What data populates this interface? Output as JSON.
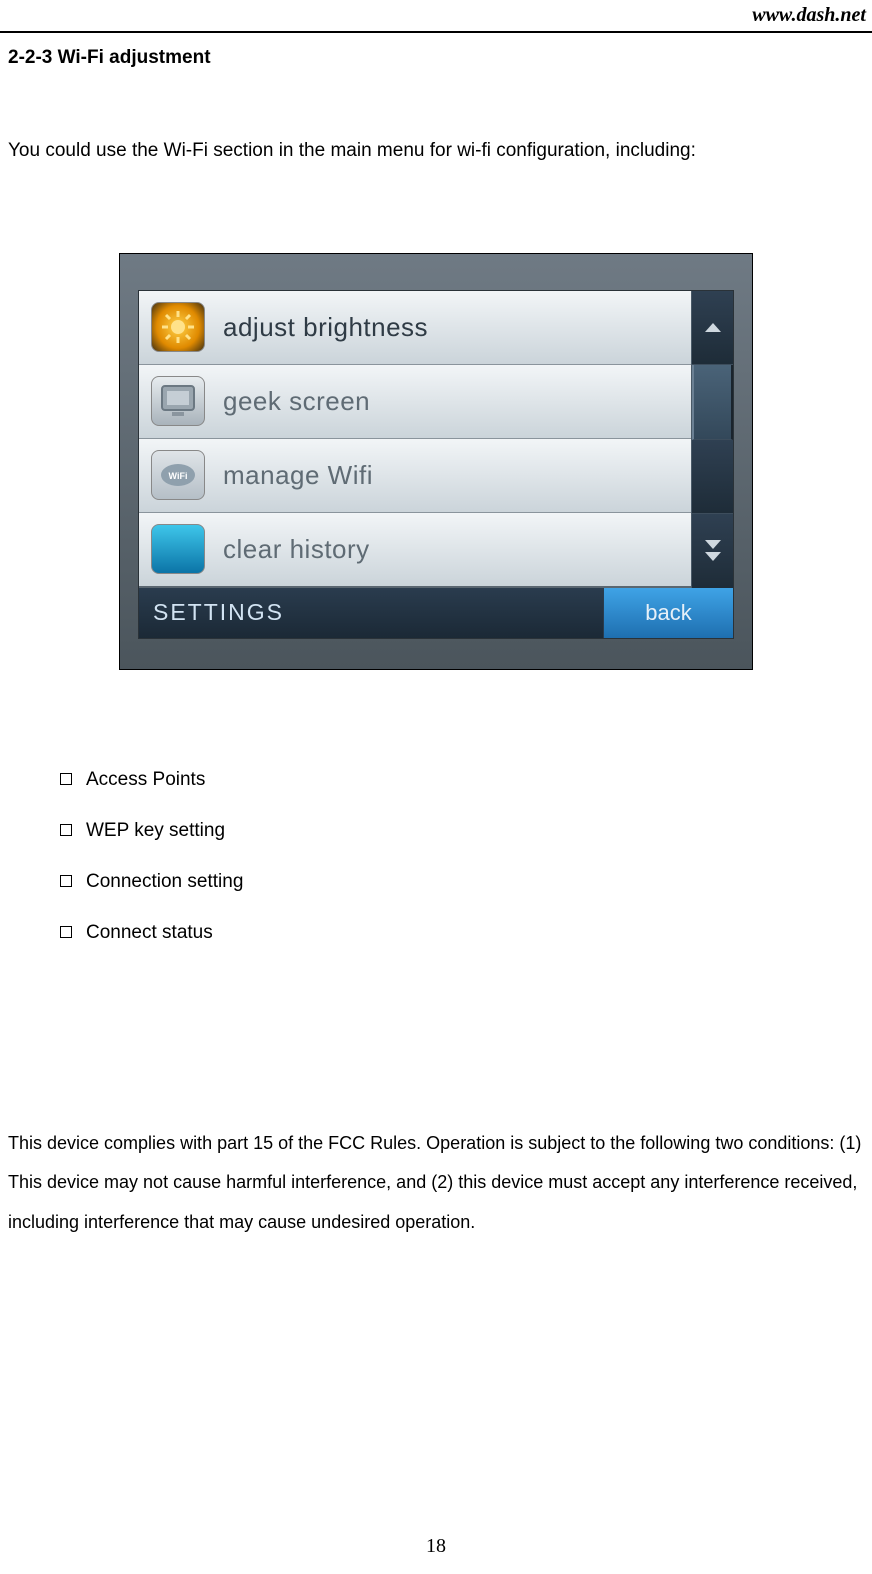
{
  "header": {
    "url": "www.dash.net"
  },
  "section": {
    "number_title": "2-2-3 Wi-Fi adjustment",
    "intro": "You could use the Wi-Fi section in the main menu for wi-fi configuration, including:"
  },
  "device_screen": {
    "menu": [
      {
        "label": "adjust brightness",
        "icon": "sun-icon"
      },
      {
        "label": "geek screen",
        "icon": "geek-icon"
      },
      {
        "label": "manage Wifi",
        "icon": "wifi-icon"
      },
      {
        "label": "clear history",
        "icon": "history-icon"
      }
    ],
    "footer_left": "SETTINGS",
    "footer_right": "back"
  },
  "bullets": [
    "Access Points",
    "WEP key setting",
    "Connection setting",
    "Connect status"
  ],
  "fcc_text": "This device complies with part 15 of the FCC Rules. Operation is subject to the following two conditions: (1) This device may not cause harmful interference, and (2) this device must accept any interference received, including interference that may cause undesired operation.",
  "page_number": "18"
}
